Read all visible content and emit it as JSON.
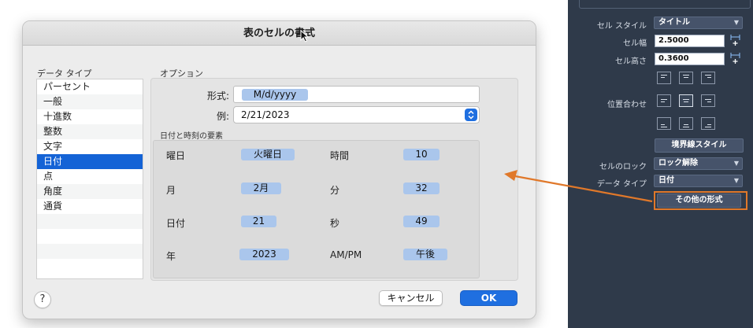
{
  "dialog": {
    "title": "表のセルの書式",
    "data_type_label": "データ タイプ",
    "data_types": [
      "パーセント",
      "一般",
      "十進数",
      "整数",
      "文字",
      "日付",
      "点",
      "角度",
      "通貨"
    ],
    "selected_type": "日付",
    "options_label": "オプション",
    "format_label": "形式:",
    "format_value": "M/d/yyyy",
    "example_label": "例:",
    "example_value": "2/21/2023",
    "elements_label": "日付と時刻の要素",
    "elements": {
      "weekday_label": "曜日",
      "weekday_value": "火曜日",
      "hour_label": "時間",
      "hour_value": "10",
      "month_label": "月",
      "month_value": "2月",
      "minute_label": "分",
      "minute_value": "32",
      "day_label": "日付",
      "day_value": "21",
      "second_label": "秒",
      "second_value": "49",
      "year_label": "年",
      "year_value": "2023",
      "ampm_label": "AM/PM",
      "ampm_value": "午後"
    },
    "help_label": "?",
    "cancel_label": "キャンセル",
    "ok_label": "OK"
  },
  "panel": {
    "cell_style_label": "セル スタイル",
    "cell_style_value": "タイトル",
    "cell_width_label": "セル幅",
    "cell_width_value": "2.5000",
    "cell_height_label": "セル高さ",
    "cell_height_value": "0.3600",
    "align_label": "位置合わせ",
    "border_style_button": "境界線スタイル",
    "cell_lock_label": "セルのロック",
    "cell_lock_value": "ロック解除",
    "data_type_label": "データ タイプ",
    "data_type_value": "日付",
    "more_formats_button": "その他の形式"
  },
  "colors": {
    "accent": "#1f6fe0",
    "selection": "#1463d6",
    "chip": "#aac6ec",
    "panel_bg": "#2f3a4a",
    "callout": "#e0782a"
  }
}
